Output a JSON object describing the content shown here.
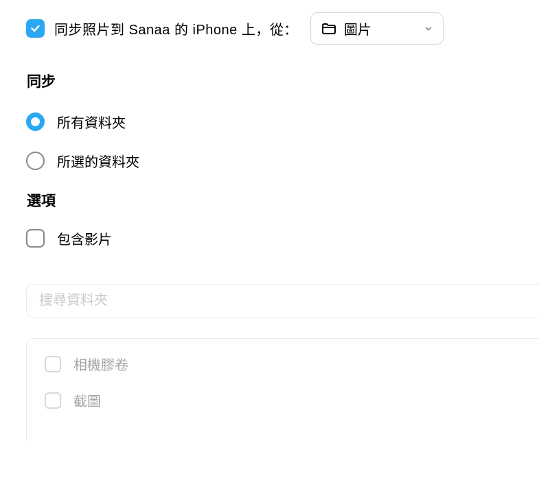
{
  "header": {
    "sync_label": "同步照片到 Sanaa 的 iPhone 上，從：",
    "dropdown_value": "圖片"
  },
  "sections": {
    "sync_heading": "同步",
    "options_heading": "選項"
  },
  "radios": {
    "all_folders": "所有資料夾",
    "selected_folders": "所選的資料夾"
  },
  "options": {
    "include_videos": "包含影片"
  },
  "search": {
    "placeholder": "搜尋資料夾"
  },
  "folders": {
    "camera_roll": "相機膠卷",
    "screenshots": "截圖"
  }
}
